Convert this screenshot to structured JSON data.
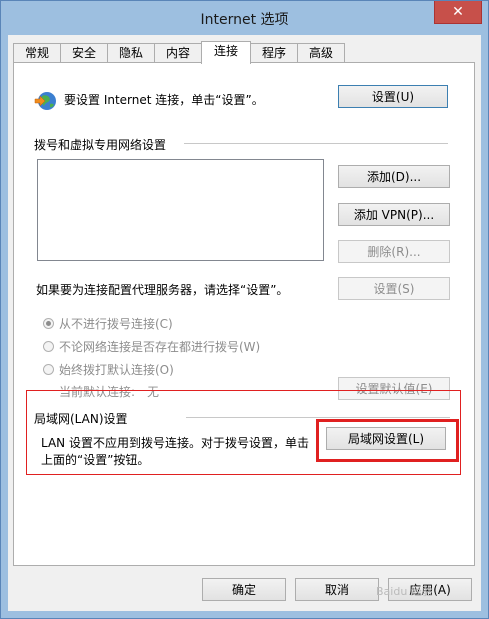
{
  "window": {
    "title": "Internet 选项",
    "close_label": "✕"
  },
  "tabs": [
    {
      "label": "常规"
    },
    {
      "label": "安全"
    },
    {
      "label": "隐私"
    },
    {
      "label": "内容"
    },
    {
      "label": "连接",
      "active": true
    },
    {
      "label": "程序"
    },
    {
      "label": "高级"
    }
  ],
  "setup": {
    "text": "要设置 Internet 连接，单击“设置”。",
    "button": "设置(U)"
  },
  "dialup": {
    "heading": "拨号和虚拟专用网络设置",
    "add_button": "添加(D)...",
    "add_vpn_button": "添加 VPN(P)...",
    "remove_button": "删除(R)...",
    "proxy_text": "如果要为连接配置代理服务器，请选择“设置”。",
    "settings_button": "设置(S)",
    "radio_never": "从不进行拨号连接(C)",
    "radio_when_none": "不论网络连接是否存在都进行拨号(W)",
    "radio_always": "始终拨打默认连接(O)",
    "current_default_label": "当前默认连接:",
    "current_default_value": "无",
    "set_default_button": "设置默认值(E)"
  },
  "lan": {
    "heading": "局域网(LAN)设置",
    "text_line1": "LAN 设置不应用到拨号连接。对于拨号设置，单击",
    "text_line2": "上面的“设置”按钮。",
    "button": "局域网设置(L)"
  },
  "footer": {
    "ok": "确定",
    "cancel": "取消",
    "apply": "应用(A)"
  },
  "watermark": "Baidu 经验",
  "colors": {
    "highlight": "#e02020",
    "titlebar": "#9dbfe0",
    "close": "#c7504a"
  }
}
